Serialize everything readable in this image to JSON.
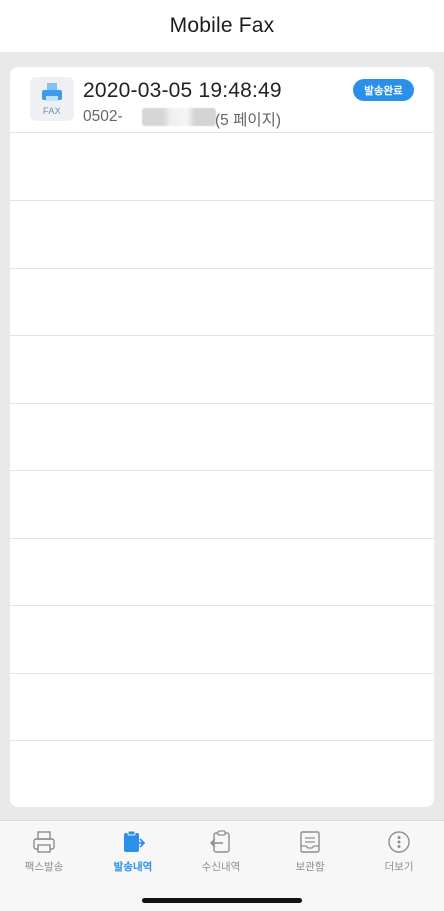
{
  "header": {
    "title": "Mobile Fax"
  },
  "list": {
    "rows": [
      {
        "thumb_label": "FAX",
        "date": "2020-03-05 19:48:49",
        "number_prefix": "0502-",
        "pages": "(5 페이지)",
        "status": "발송완료"
      }
    ]
  },
  "tabs": [
    {
      "label": "팩스발송",
      "icon": "printer-icon",
      "active": false
    },
    {
      "label": "발송내역",
      "icon": "sent-history-icon",
      "active": true
    },
    {
      "label": "수신내역",
      "icon": "received-history-icon",
      "active": false
    },
    {
      "label": "보관함",
      "icon": "archive-box-icon",
      "active": false
    },
    {
      "label": "더보기",
      "icon": "more-icon",
      "active": false
    }
  ],
  "colors": {
    "accent": "#2a90ea",
    "background": "#e9e9ea",
    "inactive": "#8e8e93"
  }
}
